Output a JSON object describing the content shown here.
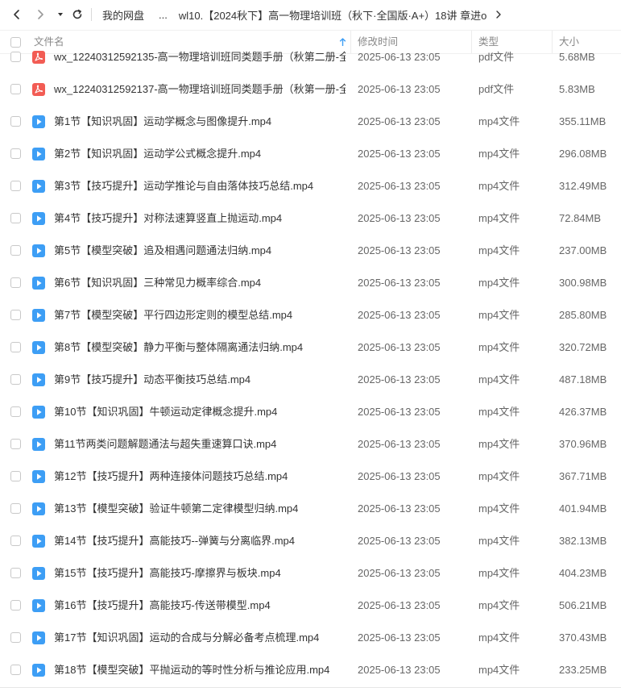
{
  "breadcrumb": {
    "items": [
      "我的网盘",
      "...",
      "wl10.【2024秋下】高一物理培训班（秋下·全国版·A+）18讲 章进o"
    ]
  },
  "header": {
    "name": "文件名",
    "time": "修改时间",
    "type": "类型",
    "size": "大小"
  },
  "colors": {
    "pdf": "#f25c54",
    "video": "#3d9ef5",
    "sort_arrow": "#3d9ef5"
  },
  "files": [
    {
      "icon": "pdf-icon",
      "name": "wx_12240312592135-高一物理培训班同类题手册（秋第二册-全...",
      "time": "2025-06-13 23:05",
      "type": "pdf文件",
      "size": "5.68MB"
    },
    {
      "icon": "pdf-icon",
      "name": "wx_12240312592137-高一物理培训班同类题手册（秋第一册-全...",
      "time": "2025-06-13 23:05",
      "type": "pdf文件",
      "size": "5.83MB"
    },
    {
      "icon": "video-icon",
      "name": "第1节【知识巩固】运动学概念与图像提升.mp4",
      "time": "2025-06-13 23:05",
      "type": "mp4文件",
      "size": "355.11MB"
    },
    {
      "icon": "video-icon",
      "name": "第2节【知识巩固】运动学公式概念提升.mp4",
      "time": "2025-06-13 23:05",
      "type": "mp4文件",
      "size": "296.08MB"
    },
    {
      "icon": "video-icon",
      "name": "第3节【技巧提升】运动学推论与自由落体技巧总结.mp4",
      "time": "2025-06-13 23:05",
      "type": "mp4文件",
      "size": "312.49MB"
    },
    {
      "icon": "video-icon",
      "name": "第4节【技巧提升】对称法速算竖直上抛运动.mp4",
      "time": "2025-06-13 23:05",
      "type": "mp4文件",
      "size": "72.84MB"
    },
    {
      "icon": "video-icon",
      "name": "第5节【模型突破】追及相遇问题通法归纳.mp4",
      "time": "2025-06-13 23:05",
      "type": "mp4文件",
      "size": "237.00MB"
    },
    {
      "icon": "video-icon",
      "name": "第6节【知识巩固】三种常见力概率综合.mp4",
      "time": "2025-06-13 23:05",
      "type": "mp4文件",
      "size": "300.98MB"
    },
    {
      "icon": "video-icon",
      "name": "第7节【模型突破】平行四边形定则的模型总结.mp4",
      "time": "2025-06-13 23:05",
      "type": "mp4文件",
      "size": "285.80MB"
    },
    {
      "icon": "video-icon",
      "name": "第8节【模型突破】静力平衡与整体隔离通法归纳.mp4",
      "time": "2025-06-13 23:05",
      "type": "mp4文件",
      "size": "320.72MB"
    },
    {
      "icon": "video-icon",
      "name": "第9节【技巧提升】动态平衡技巧总结.mp4",
      "time": "2025-06-13 23:05",
      "type": "mp4文件",
      "size": "487.18MB"
    },
    {
      "icon": "video-icon",
      "name": "第10节【知识巩固】牛顿运动定律概念提升.mp4",
      "time": "2025-06-13 23:05",
      "type": "mp4文件",
      "size": "426.37MB"
    },
    {
      "icon": "video-icon",
      "name": "第11节两类问题解题通法与超失重速算口诀.mp4",
      "time": "2025-06-13 23:05",
      "type": "mp4文件",
      "size": "370.96MB"
    },
    {
      "icon": "video-icon",
      "name": "第12节【技巧提升】两种连接体问题技巧总结.mp4",
      "time": "2025-06-13 23:05",
      "type": "mp4文件",
      "size": "367.71MB"
    },
    {
      "icon": "video-icon",
      "name": "第13节【模型突破】验证牛顿第二定律模型归纳.mp4",
      "time": "2025-06-13 23:05",
      "type": "mp4文件",
      "size": "401.94MB"
    },
    {
      "icon": "video-icon",
      "name": "第14节【技巧提升】高能技巧--弹簧与分离临界.mp4",
      "time": "2025-06-13 23:05",
      "type": "mp4文件",
      "size": "382.13MB"
    },
    {
      "icon": "video-icon",
      "name": "第15节【技巧提升】高能技巧-摩擦界与板块.mp4",
      "time": "2025-06-13 23:05",
      "type": "mp4文件",
      "size": "404.23MB"
    },
    {
      "icon": "video-icon",
      "name": "第16节【技巧提升】高能技巧-传送带模型.mp4",
      "time": "2025-06-13 23:05",
      "type": "mp4文件",
      "size": "506.21MB"
    },
    {
      "icon": "video-icon",
      "name": "第17节【知识巩固】运动的合成与分解必备考点梳理.mp4",
      "time": "2025-06-13 23:05",
      "type": "mp4文件",
      "size": "370.43MB"
    },
    {
      "icon": "video-icon",
      "name": "第18节【模型突破】平抛运动的等时性分析与推论应用.mp4",
      "time": "2025-06-13 23:05",
      "type": "mp4文件",
      "size": "233.25MB"
    }
  ]
}
